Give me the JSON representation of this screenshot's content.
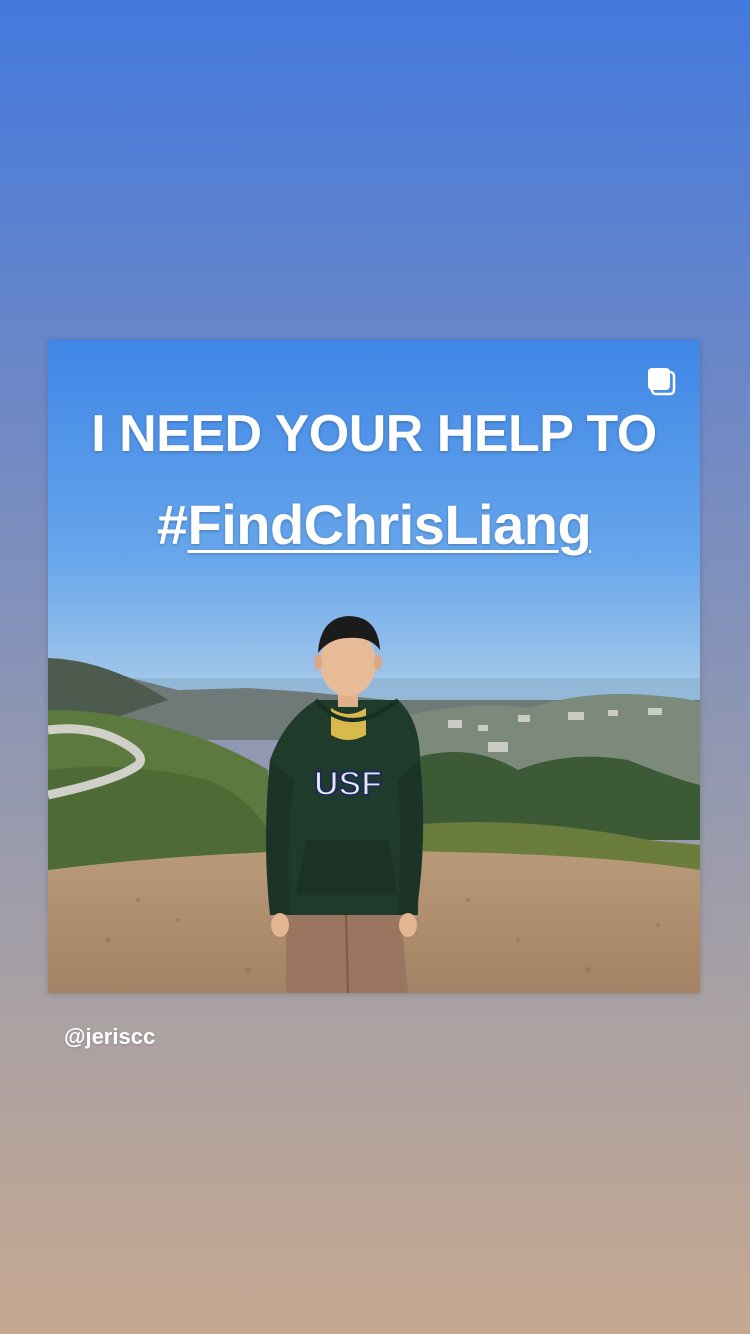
{
  "story": {
    "headline": "I NEED YOUR HELP TO",
    "hashtag_symbol": "#",
    "hashtag_word": "FindChrisLiang",
    "hoodie_text": "USF",
    "username": "@jeriscc",
    "multi_post_icon": "multiple-posts-icon"
  },
  "colors": {
    "background_top": "#4379dd",
    "background_bottom": "#c6a891",
    "sky": "#4f8ee8",
    "hoodie": "#1f3b2c"
  }
}
